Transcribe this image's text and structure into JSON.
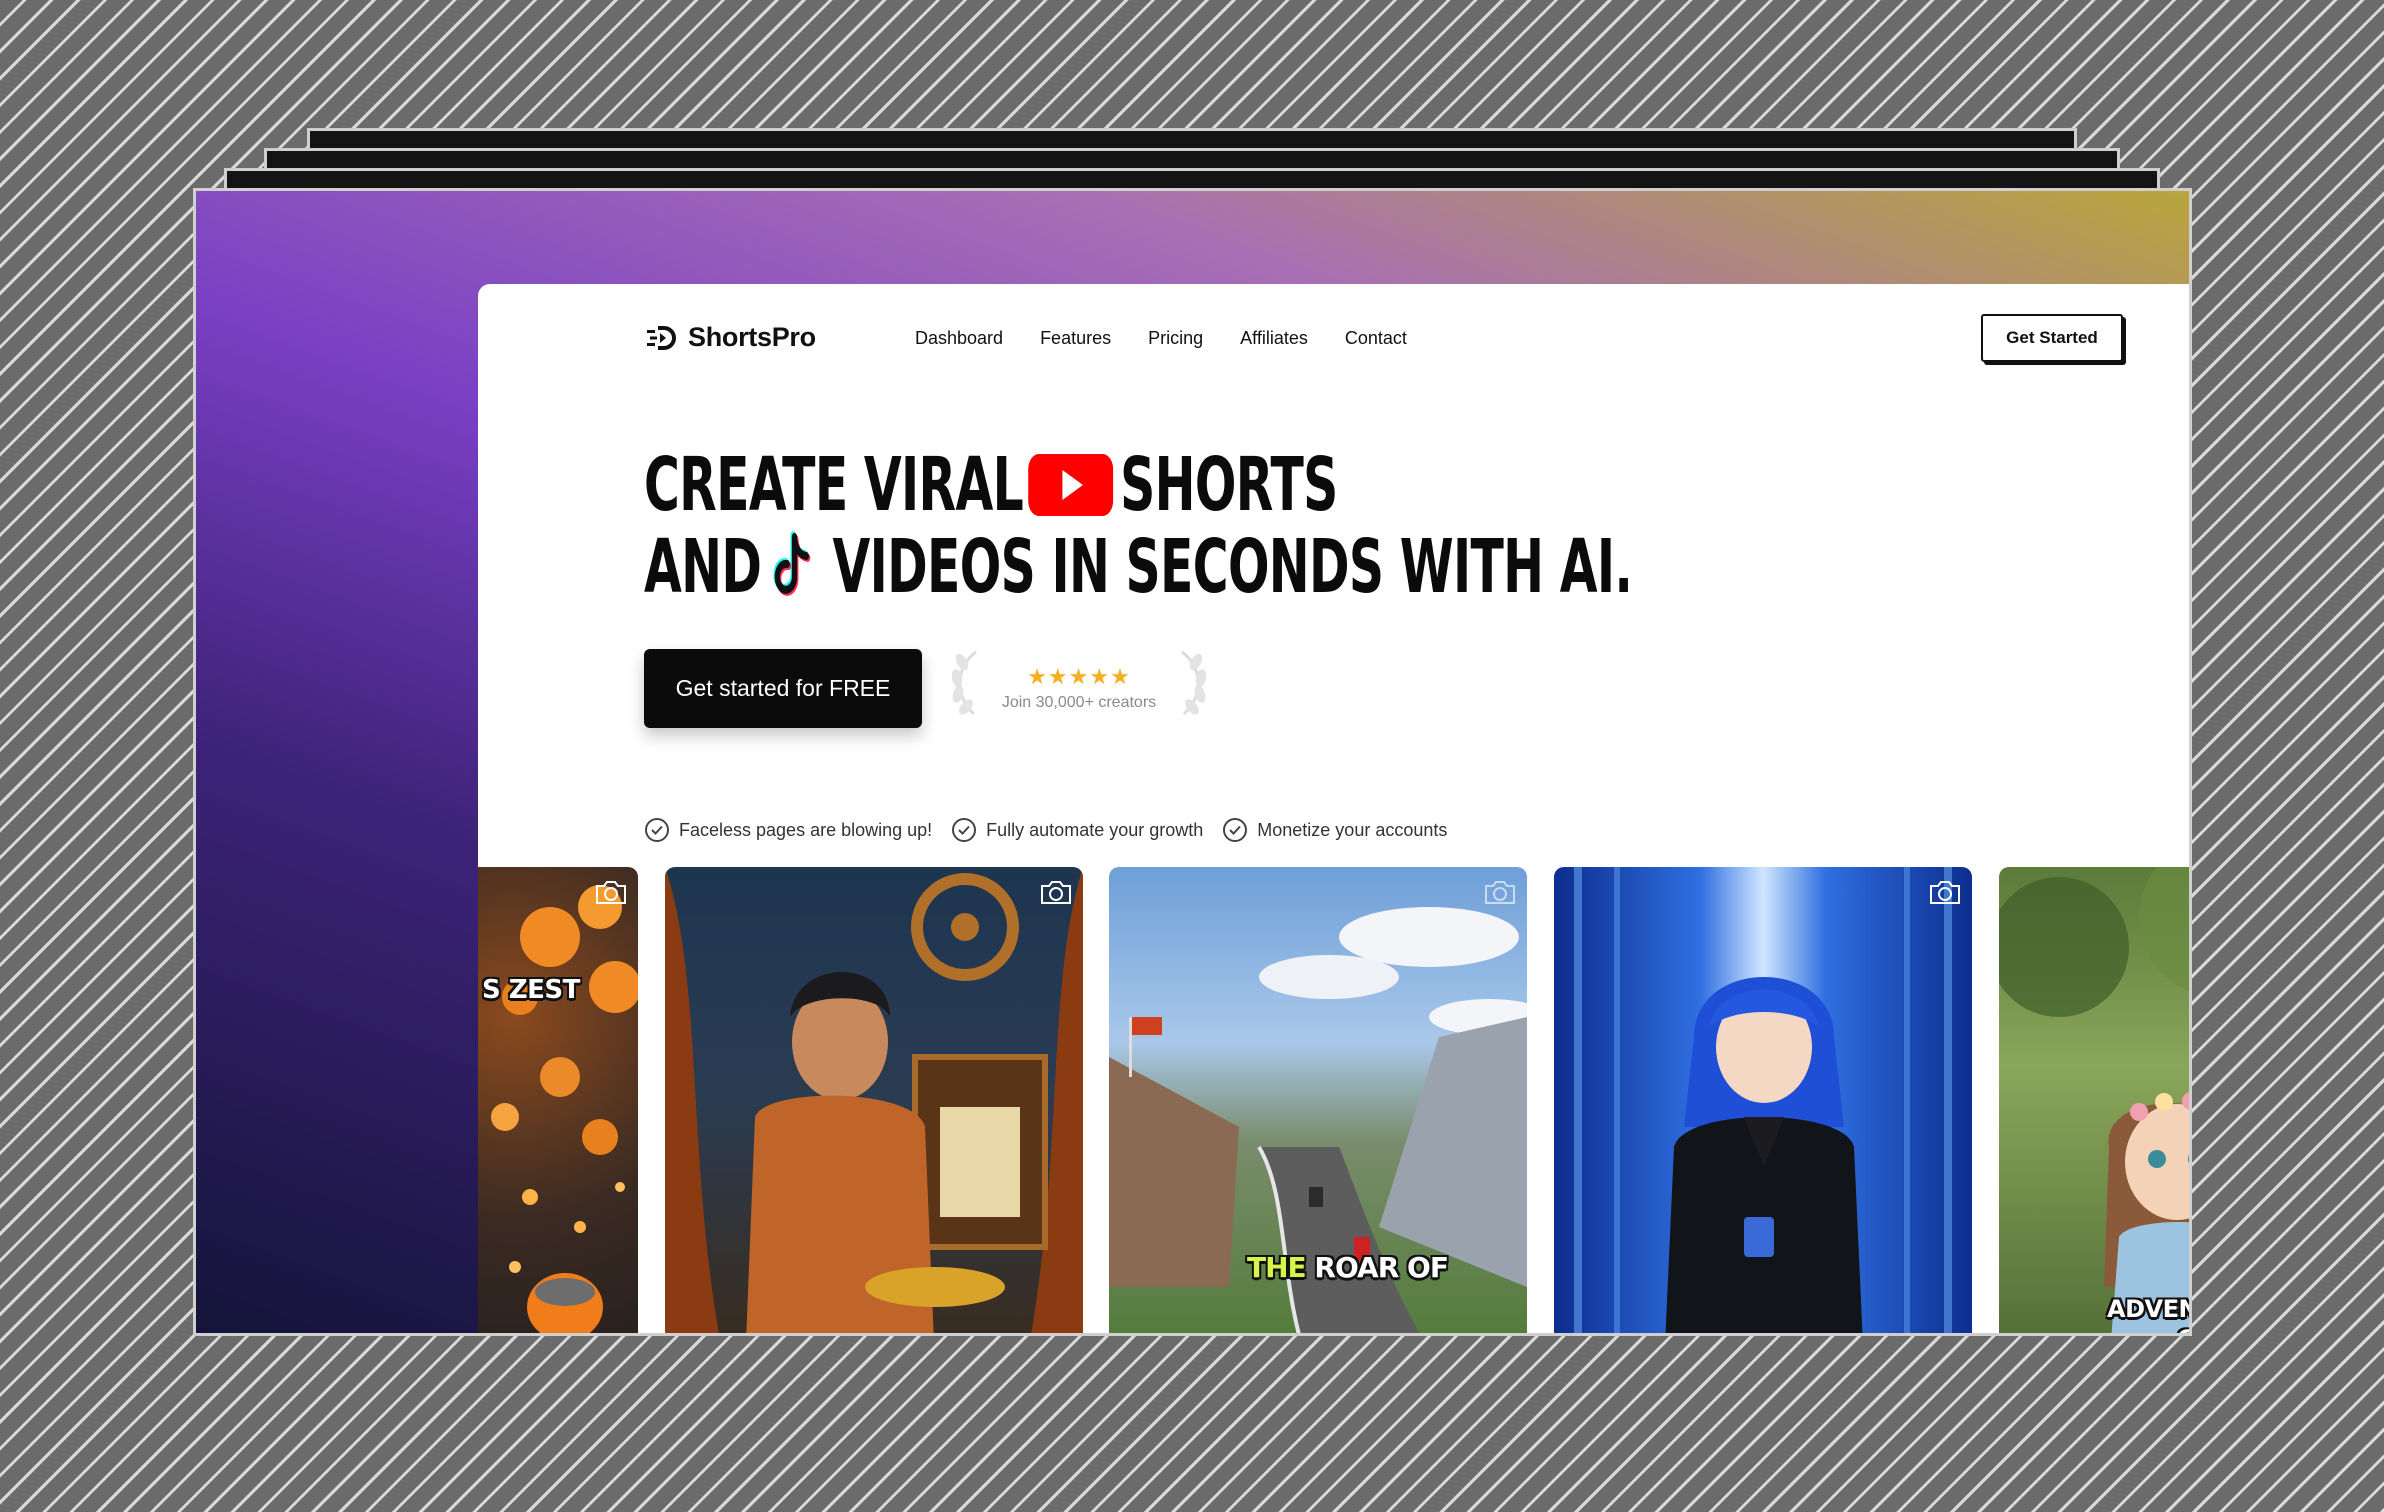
{
  "brand": {
    "name": "ShortsPro",
    "icon": "shortspro-logo-icon"
  },
  "nav": {
    "links": [
      "Dashboard",
      "Features",
      "Pricing",
      "Affiliates",
      "Contact"
    ],
    "cta_label": "Get Started"
  },
  "hero": {
    "line1_part1": "CREATE VIRAL",
    "line1_icon": "youtube-icon",
    "line1_part2": "SHORTS",
    "line2_part1": "AND",
    "line2_icon": "tiktok-icon",
    "line2_part2": "VIDEOS IN SECONDS WITH AI."
  },
  "cta_primary_label": "Get started for FREE",
  "rating": {
    "stars": "★★★★★",
    "stars_count": 5,
    "text": "Join 30,000+ creators"
  },
  "features": [
    "Faceless pages are blowing up!",
    "Fully automate your growth",
    "Monetize your accounts"
  ],
  "gallery": [
    {
      "caption": "S ZEST",
      "icon": "camera-icon"
    },
    {
      "caption": "",
      "icon": "camera-icon"
    },
    {
      "caption_a": "THE",
      "caption_b": "ROAR OF",
      "icon": "camera-icon"
    },
    {
      "caption": "",
      "icon": "camera-icon"
    },
    {
      "caption": "ADVENTUROUS",
      "caption2": "GIRL",
      "icon": "camera-icon"
    }
  ],
  "colors": {
    "text": "#0b0b0b",
    "youtube_red": "#ff0000",
    "star": "#f5b021",
    "gradient_purple": "#7a3fc4",
    "gradient_yellow": "#b9a63a"
  }
}
